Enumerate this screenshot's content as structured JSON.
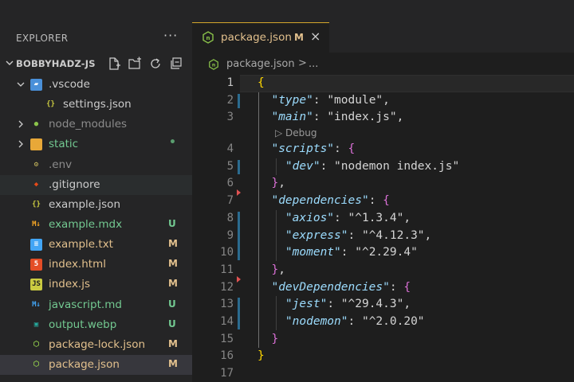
{
  "sidebar": {
    "title": "EXPLORER",
    "more": "···",
    "project": "BOBBYHADZ-JS",
    "items": [
      {
        "name": ".vscode",
        "type": "folder-open",
        "indent": 0,
        "status": "",
        "color": "default",
        "icon": "vscode-folder-icon"
      },
      {
        "name": "settings.json",
        "type": "file",
        "indent": 1,
        "status": "",
        "color": "default",
        "icon": "json-icon"
      },
      {
        "name": "node_modules",
        "type": "folder",
        "indent": 0,
        "status": "",
        "color": "ignored",
        "icon": "node-folder-icon"
      },
      {
        "name": "static",
        "type": "folder",
        "indent": 0,
        "status": "•",
        "color": "untracked",
        "icon": "folder-icon"
      },
      {
        "name": ".env",
        "type": "file",
        "indent": 0,
        "status": "",
        "color": "ignored",
        "icon": "env-icon"
      },
      {
        "name": ".gitignore",
        "type": "file",
        "indent": 0,
        "status": "",
        "color": "default",
        "icon": "git-icon"
      },
      {
        "name": "example.json",
        "type": "file",
        "indent": 0,
        "status": "",
        "color": "default",
        "icon": "json-icon"
      },
      {
        "name": "example.mdx",
        "type": "file",
        "indent": 0,
        "status": "U",
        "color": "untracked",
        "icon": "mdx-icon"
      },
      {
        "name": "example.txt",
        "type": "file",
        "indent": 0,
        "status": "M",
        "color": "modified",
        "icon": "txt-icon"
      },
      {
        "name": "index.html",
        "type": "file",
        "indent": 0,
        "status": "M",
        "color": "modified",
        "icon": "html-icon"
      },
      {
        "name": "index.js",
        "type": "file",
        "indent": 0,
        "status": "M",
        "color": "modified",
        "icon": "js-icon"
      },
      {
        "name": "javascript.md",
        "type": "file",
        "indent": 0,
        "status": "U",
        "color": "untracked",
        "icon": "md-icon"
      },
      {
        "name": "output.webp",
        "type": "file",
        "indent": 0,
        "status": "U",
        "color": "untracked",
        "icon": "image-icon"
      },
      {
        "name": "package-lock.json",
        "type": "file",
        "indent": 0,
        "status": "M",
        "color": "modified",
        "icon": "node-icon"
      },
      {
        "name": "package.json",
        "type": "file",
        "indent": 0,
        "status": "M",
        "color": "modified",
        "icon": "node-icon"
      }
    ]
  },
  "tab": {
    "label": "package.json",
    "modified": "M",
    "close": "×"
  },
  "breadcrumb": {
    "file": "package.json",
    "separator": ">",
    "ellipsis": "..."
  },
  "codelens": "Debug",
  "code": [
    {
      "n": "1",
      "tokens": [
        [
          "{",
          "t-brace1"
        ]
      ]
    },
    {
      "n": "2",
      "tokens": [
        [
          "  ",
          ""
        ],
        [
          "\"type\"",
          "t-key"
        ],
        [
          ": ",
          "t-punc"
        ],
        [
          "\"module\"",
          "t-str2"
        ],
        [
          ",",
          "t-punc"
        ]
      ]
    },
    {
      "n": "3",
      "tokens": [
        [
          "  ",
          ""
        ],
        [
          "\"main\"",
          "t-key"
        ],
        [
          ": ",
          "t-punc"
        ],
        [
          "\"index.js\"",
          "t-str2"
        ],
        [
          ",",
          "t-punc"
        ]
      ]
    },
    {
      "n": "4",
      "tokens": [
        [
          "  ",
          ""
        ],
        [
          "\"scripts\"",
          "t-key"
        ],
        [
          ": ",
          "t-punc"
        ],
        [
          "{",
          "t-brace2"
        ]
      ]
    },
    {
      "n": "5",
      "tokens": [
        [
          "    ",
          ""
        ],
        [
          "\"dev\"",
          "t-key"
        ],
        [
          ": ",
          "t-punc"
        ],
        [
          "\"nodemon index.js\"",
          "t-str2"
        ]
      ]
    },
    {
      "n": "6",
      "tokens": [
        [
          "  ",
          ""
        ],
        [
          "}",
          "t-brace2"
        ],
        [
          ",",
          "t-punc"
        ]
      ]
    },
    {
      "n": "7",
      "tokens": [
        [
          "  ",
          ""
        ],
        [
          "\"dependencies\"",
          "t-key"
        ],
        [
          ": ",
          "t-punc"
        ],
        [
          "{",
          "t-brace2"
        ]
      ]
    },
    {
      "n": "8",
      "tokens": [
        [
          "    ",
          ""
        ],
        [
          "\"axios\"",
          "t-key"
        ],
        [
          ": ",
          "t-punc"
        ],
        [
          "\"^1.3.4\"",
          "t-str2"
        ],
        [
          ",",
          "t-punc"
        ]
      ]
    },
    {
      "n": "9",
      "tokens": [
        [
          "    ",
          ""
        ],
        [
          "\"express\"",
          "t-key"
        ],
        [
          ": ",
          "t-punc"
        ],
        [
          "\"^4.12.3\"",
          "t-str2"
        ],
        [
          ",",
          "t-punc"
        ]
      ]
    },
    {
      "n": "10",
      "tokens": [
        [
          "    ",
          ""
        ],
        [
          "\"moment\"",
          "t-key"
        ],
        [
          ": ",
          "t-punc"
        ],
        [
          "\"^2.29.4\"",
          "t-str2"
        ]
      ]
    },
    {
      "n": "11",
      "tokens": [
        [
          "  ",
          ""
        ],
        [
          "}",
          "t-brace2"
        ],
        [
          ",",
          "t-punc"
        ]
      ]
    },
    {
      "n": "12",
      "tokens": [
        [
          "  ",
          ""
        ],
        [
          "\"devDependencies\"",
          "t-key"
        ],
        [
          ": ",
          "t-punc"
        ],
        [
          "{",
          "t-brace2"
        ]
      ]
    },
    {
      "n": "13",
      "tokens": [
        [
          "    ",
          ""
        ],
        [
          "\"jest\"",
          "t-key"
        ],
        [
          ": ",
          "t-punc"
        ],
        [
          "\"^29.4.3\"",
          "t-str2"
        ],
        [
          ",",
          "t-punc"
        ]
      ]
    },
    {
      "n": "14",
      "tokens": [
        [
          "    ",
          ""
        ],
        [
          "\"nodemon\"",
          "t-key"
        ],
        [
          ": ",
          "t-punc"
        ],
        [
          "\"^2.0.20\"",
          "t-str2"
        ]
      ]
    },
    {
      "n": "15",
      "tokens": [
        [
          "  ",
          ""
        ],
        [
          "}",
          "t-brace2"
        ]
      ]
    },
    {
      "n": "16",
      "tokens": [
        [
          "}",
          "t-brace1"
        ]
      ]
    },
    {
      "n": "17",
      "tokens": []
    }
  ],
  "colors": {
    "modified": "#e2c08d",
    "untracked": "#73c991",
    "ignored": "#8c8c8c",
    "tab_accent": "#d4a72c"
  }
}
